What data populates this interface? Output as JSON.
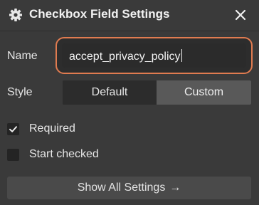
{
  "header": {
    "title": "Checkbox Field Settings",
    "icon": "gear-icon",
    "close_icon": "close-icon"
  },
  "fields": {
    "name_label": "Name",
    "name_value": "accept_privacy_policy",
    "style_label": "Style",
    "style_options": [
      "Default",
      "Custom"
    ],
    "style_selected": "Custom"
  },
  "checkboxes": [
    {
      "label": "Required",
      "checked": true
    },
    {
      "label": "Start checked",
      "checked": false
    }
  ],
  "footer": {
    "show_all_label": "Show All Settings",
    "arrow": "→"
  },
  "colors": {
    "panel_bg": "#3a3a3a",
    "focus_ring": "#e07b50",
    "segment_selected": "#595959"
  }
}
